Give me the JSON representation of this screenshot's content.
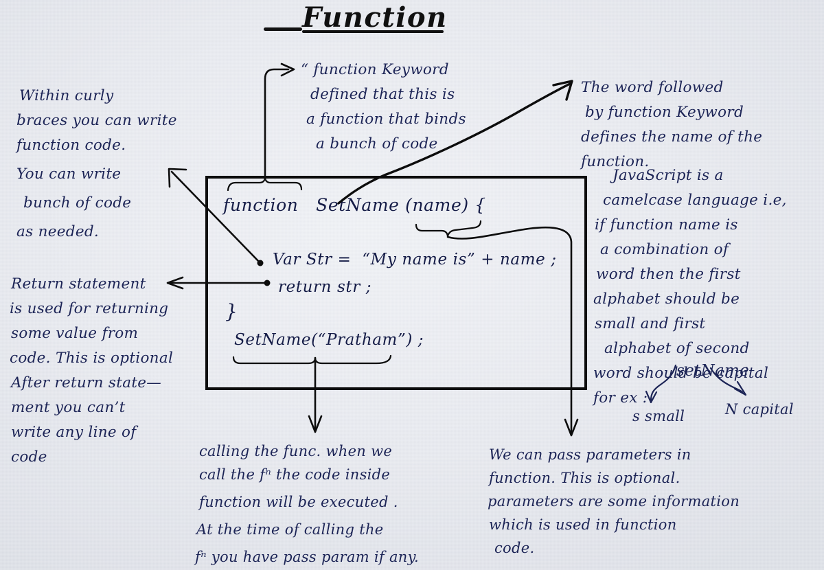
{
  "page": {
    "title": "Function",
    "paper_color": "#e9ebf0",
    "ink_color": "#1c2456",
    "marker_color": "#0d0d0d"
  },
  "notes": {
    "top_left": {
      "name": "curly-braces-note",
      "lines": [
        "Within curly",
        "braces you can write",
        "function code.",
        "You can write",
        "bunch of code",
        "as needed."
      ]
    },
    "top_middle": {
      "name": "function-keyword-note",
      "lines": [
        "“ function Keyword",
        "defined that this is",
        "a function that binds",
        "a bunch of code"
      ]
    },
    "top_right": {
      "name": "function-name-note",
      "lines": [
        "The word followed",
        "by function Keyword",
        "defines the name of the",
        "function."
      ]
    },
    "right_camelcase": {
      "name": "camelcase-note",
      "lines": [
        "JavaScript is a",
        "camelcase language i.e,",
        "if function name is",
        "a combination of",
        "word then the first",
        "alphabet should be",
        "small and first",
        "alphabet of second",
        "word should be capital",
        "for ex :"
      ],
      "example": "setName",
      "callouts": [
        {
          "name": "s-small-label",
          "text": "s small"
        },
        {
          "name": "n-capital-label",
          "text": "N capital"
        }
      ]
    },
    "left_return": {
      "name": "return-statement-note",
      "lines": [
        "Return statement",
        "is used for returning",
        "some value from",
        "code. This is optional",
        "After return state—",
        "ment you can’t",
        "write any line of",
        "code"
      ]
    },
    "bottom_middle": {
      "name": "calling-function-note",
      "lines": [
        "calling the func. when we",
        "call the fⁿ the code inside",
        "function will be executed .",
        "At the time of calling the",
        "fⁿ you have pass param if any."
      ]
    },
    "bottom_right": {
      "name": "parameters-note",
      "lines": [
        "We can pass parameters in",
        "function. This is optional.",
        "parameters are some information",
        "which is used in function",
        "code."
      ]
    }
  },
  "code_box": {
    "name": "code-snippet-box",
    "lines": [
      {
        "name": "code-line-signature",
        "text": "function   SetName (name) {"
      },
      {
        "name": "code-line-var",
        "text": "Var Str =  “My name is” + name ;"
      },
      {
        "name": "code-line-return",
        "text": "return str ;"
      },
      {
        "name": "code-line-close-brace",
        "text": "}"
      },
      {
        "name": "code-line-call",
        "text": "SetName(“Pratham”) ;"
      }
    ]
  },
  "connectors": [
    {
      "name": "brace-function-keyword",
      "from": "function keyword",
      "to": "function-keyword-note"
    },
    {
      "name": "arrow-function-name",
      "from": "SetName",
      "to": "function-name-note"
    },
    {
      "name": "arrow-curly-braces",
      "from": "open brace",
      "to": "curly-braces-note"
    },
    {
      "name": "arrow-return-statement",
      "from": "return str ;",
      "to": "return-statement-note"
    },
    {
      "name": "arrow-calling-function",
      "from": "SetName(“Pratham”) ;",
      "to": "calling-function-note"
    },
    {
      "name": "arrow-parameters",
      "from": "(name)",
      "to": "parameters-note"
    },
    {
      "name": "arrow-s-small",
      "from": "setName",
      "to": "s-small-label"
    },
    {
      "name": "arrow-n-capital",
      "from": "setName",
      "to": "n-capital-label"
    }
  ]
}
